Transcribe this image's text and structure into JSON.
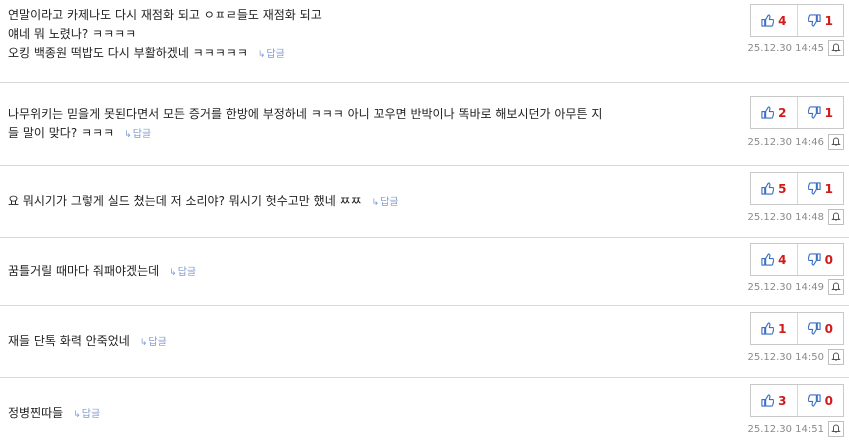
{
  "comments": [
    {
      "lines": [
        "연말이라고 카제나도 다시 재점화 되고 ㅇㅍㄹ들도 재점화 되고",
        "얘네 뭐 노렸나? ㅋㅋㅋㅋ",
        "오킹 백종원 떡밥도 다시 부활하겠네 ㅋㅋㅋㅋㅋ"
      ],
      "reply_label": "답글",
      "likes": "4",
      "dislikes": "1",
      "date": "25.12.30 14:45"
    },
    {
      "lines": [
        "나무위키는 믿을게 못된다면서 모든 증거를 한방에 부정하네 ㅋㅋㅋ 아니 꼬우면 반박이나 똑바로 해보시던가 아무튼 지",
        "들 말이 맞다? ㅋㅋㅋ"
      ],
      "reply_label": "답글",
      "likes": "2",
      "dislikes": "1",
      "date": "25.12.30 14:46"
    },
    {
      "lines": [
        "요 뭐시기가 그렇게 실드 쳤는데 저 소리야? 뭐시기 헛수고만 했네 ㅉㅉ"
      ],
      "reply_label": "답글",
      "likes": "5",
      "dislikes": "1",
      "date": "25.12.30 14:48"
    },
    {
      "lines": [
        "꿈틀거릴 때마다 줘패야겠는데"
      ],
      "reply_label": "답글",
      "likes": "4",
      "dislikes": "0",
      "date": "25.12.30 14:49"
    },
    {
      "lines": [
        "재들 단톡 화력 안죽었네"
      ],
      "reply_label": "답글",
      "likes": "1",
      "dislikes": "0",
      "date": "25.12.30 14:50"
    },
    {
      "lines": [
        "정병찐따들"
      ],
      "reply_label": "답글",
      "likes": "3",
      "dislikes": "0",
      "date": "25.12.30 14:51"
    }
  ],
  "colors": {
    "count": "#d11a1a",
    "thumb_up": "#3b6fc2",
    "thumb_down": "#c0392b",
    "reply": "#7f9bd0",
    "date": "#8a8a8a"
  },
  "icons": {
    "like": "thumbs-up-icon",
    "dislike": "thumbs-down-icon",
    "report": "bell-icon",
    "reply": "reply-arrow-icon"
  }
}
